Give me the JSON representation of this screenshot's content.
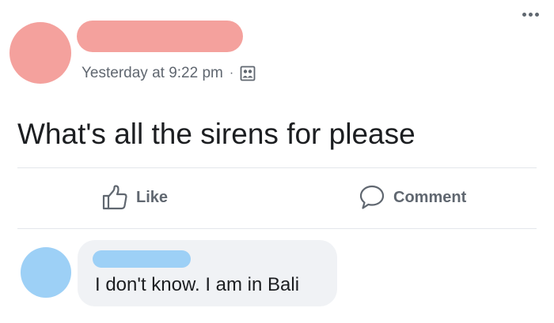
{
  "post": {
    "timestamp": "Yesterday at 9:22 pm",
    "separator": "·",
    "audience_icon": "friends-icon",
    "text": "What's all the sirens for please",
    "more_icon": "ellipsis-icon"
  },
  "actions": {
    "like_label": "Like",
    "like_icon": "thumbs-up-icon",
    "comment_label": "Comment",
    "comment_icon": "speech-bubble-icon"
  },
  "comment": {
    "text": "I don't know. I am in Bali"
  },
  "colors": {
    "poster_redaction": "#f4a19d",
    "commenter_redaction": "#9dd0f6",
    "muted_text": "#606770",
    "bubble_bg": "#f0f2f5",
    "divider": "#e4e6eb"
  }
}
